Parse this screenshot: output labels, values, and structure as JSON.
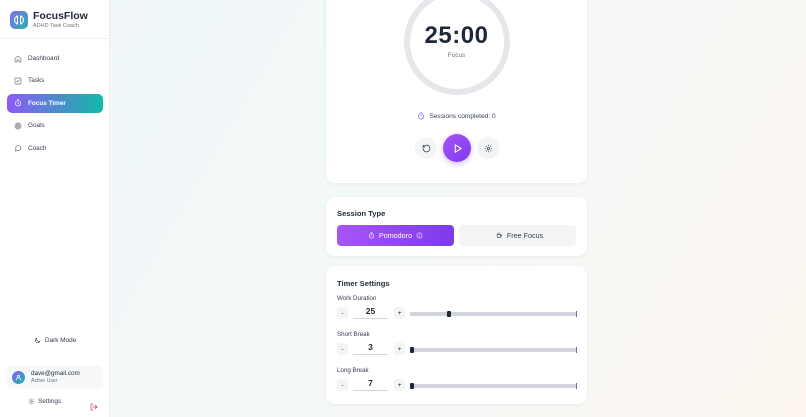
{
  "app": {
    "name": "FocusFlow",
    "subtitle": "ADHD Task Coach"
  },
  "nav": {
    "items": [
      {
        "label": "Dashboard",
        "icon": "home-icon",
        "active": false
      },
      {
        "label": "Tasks",
        "icon": "checkbox-icon",
        "active": false
      },
      {
        "label": "Focus Timer",
        "icon": "timer-icon",
        "active": true
      },
      {
        "label": "Goals",
        "icon": "target-icon",
        "active": false
      },
      {
        "label": "Coach",
        "icon": "chat-icon",
        "active": false
      }
    ]
  },
  "sidebar_footer": {
    "dark_mode_label": "Dark Mode",
    "user_email": "dave@gmail.com",
    "user_status": "Active User",
    "settings_label": "Settings"
  },
  "timer": {
    "time": "25:00",
    "mode": "Focus",
    "progress": 0,
    "sessions_text": "Sessions completed: 0"
  },
  "session_type": {
    "title": "Session Type",
    "options": [
      {
        "label": "Pomodoro",
        "selected": true
      },
      {
        "label": "Free Focus",
        "selected": false
      }
    ]
  },
  "timer_settings": {
    "title": "Timer Settings",
    "decrement_label": "-",
    "increment_label": "+",
    "fields": [
      {
        "label": "Work Duration",
        "value": "25",
        "slider_fraction": 0.23
      },
      {
        "label": "Short Break",
        "value": "3",
        "slider_fraction": 0.0
      },
      {
        "label": "Long Break",
        "value": "7",
        "slider_fraction": 0.0
      }
    ]
  },
  "colors": {
    "accent_purple": "#8b5cf6",
    "accent_teal": "#14b8a6",
    "text_dark": "#1f2937",
    "ring_gray": "#e5e7eb"
  }
}
